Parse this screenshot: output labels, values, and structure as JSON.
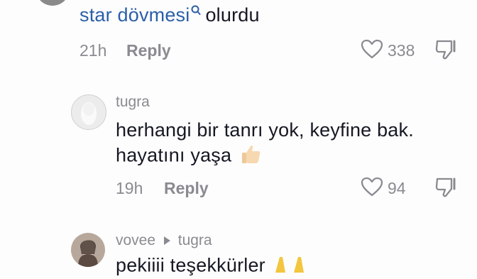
{
  "comment1": {
    "text_link": "star dövmesi",
    "text_rest": "olurdu",
    "time": "21h",
    "reply_label": "Reply",
    "likes": "338"
  },
  "comment2": {
    "username": "tugra",
    "line1": "herhangi bir tanrı yok, keyfine bak.",
    "line2": "hayatını yaşa",
    "time": "19h",
    "reply_label": "Reply",
    "likes": "94"
  },
  "comment3": {
    "username": "vovee",
    "reply_to": "tugra",
    "text": "pekiiii teşekkürler"
  },
  "colors": {
    "link": "#2b5fa8",
    "muted": "#8a8b91",
    "text": "#161823"
  },
  "icons": [
    "search-icon",
    "heart-icon",
    "dislike-icon",
    "thumbs-up-emoji",
    "praying-hands-emoji",
    "reply-arrow-icon"
  ]
}
